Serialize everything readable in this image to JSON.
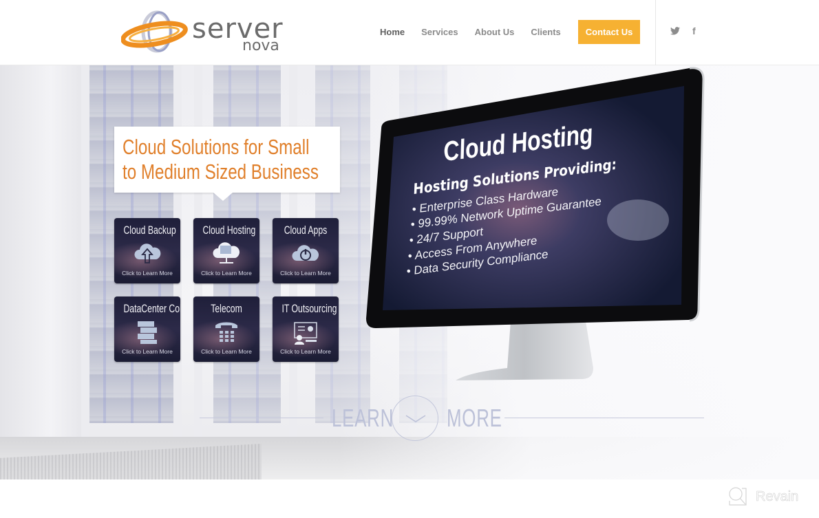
{
  "brand": {
    "name_top": "server",
    "name_bottom": "nova",
    "logo_icon": "orbit-swoosh-logo"
  },
  "nav": {
    "items": [
      {
        "label": "Home",
        "active": true
      },
      {
        "label": "Services",
        "active": false
      },
      {
        "label": "About Us",
        "active": false
      },
      {
        "label": "Clients",
        "active": false
      }
    ],
    "cta_label": "Contact Us",
    "cta_color": "#f6b132"
  },
  "social": {
    "twitter_glyph": "🐦",
    "facebook_glyph": "f",
    "icons": [
      "twitter-icon",
      "facebook-icon"
    ]
  },
  "hero": {
    "headline_line1": "Cloud Solutions for Small",
    "headline_line2": "to Medium Sized Business",
    "headline_color": "#e07f2a",
    "tiles": [
      {
        "title": "Cloud Backup",
        "subtitle": "Click to Learn More",
        "icon": "cloud-upload-icon"
      },
      {
        "title": "Cloud Hosting",
        "subtitle": "Click to Learn More",
        "icon": "cloud-network-icon"
      },
      {
        "title": "Cloud Apps",
        "subtitle": "Click to Learn More",
        "icon": "cloud-power-icon"
      },
      {
        "title": "DataCenter Colo",
        "subtitle": "Click to Learn More",
        "icon": "server-stack-icon"
      },
      {
        "title": "Telecom",
        "subtitle": "Click to Learn More",
        "icon": "telephone-icon"
      },
      {
        "title": "IT Outsourcing",
        "subtitle": "Click to Learn More",
        "icon": "it-support-icon"
      }
    ],
    "monitor": {
      "title": "Cloud Hosting",
      "subtitle": "Hosting Solutions Providing:",
      "bullets": [
        "• Enterprise Class Hardware",
        "• 99.99% Network Uptime Guarantee",
        "• 24/7 Support",
        "• Access From Anywhere",
        "• Data Security Compliance"
      ]
    },
    "learn_more": {
      "left": "LEARN",
      "right": "MORE",
      "icon": "chevron-down-icon"
    }
  },
  "watermark": {
    "text": "Revain"
  }
}
